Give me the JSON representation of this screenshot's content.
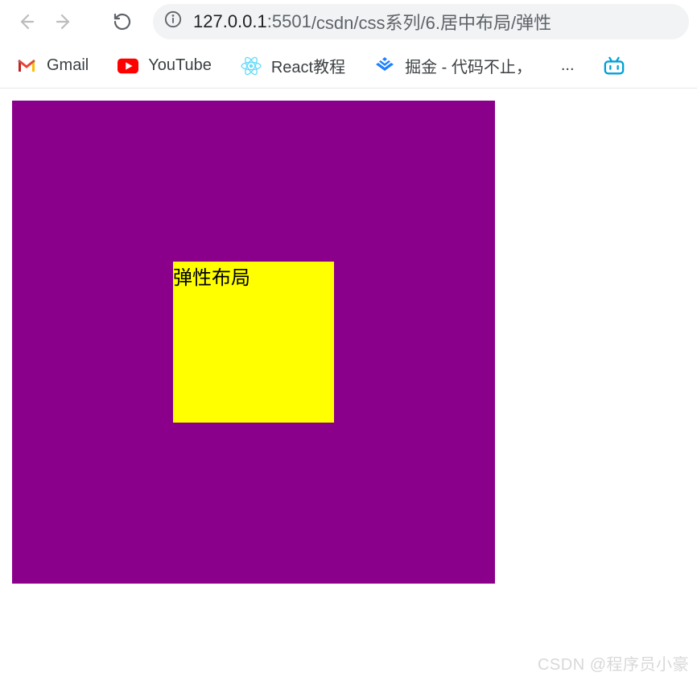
{
  "toolbar": {
    "url_host": "127.0.0.1",
    "url_port": ":5501",
    "url_path": "/csdn/css系列/6.居中布局/弹性"
  },
  "bookmarks": {
    "gmail": "Gmail",
    "youtube": "YouTube",
    "react": "React教程",
    "juejin": "掘金 - 代码不止，",
    "ellipsis": "..."
  },
  "page": {
    "inner_text": "弹性布局"
  },
  "watermark": "CSDN @程序员小豪",
  "colors": {
    "outer": "#8b008b",
    "inner": "#ffff00"
  }
}
